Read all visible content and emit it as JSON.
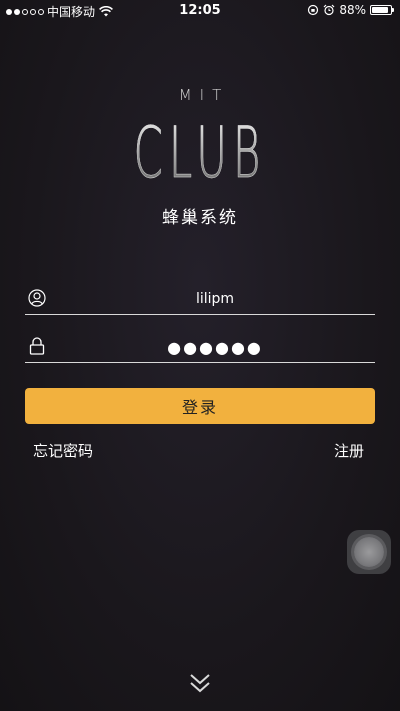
{
  "status_bar": {
    "carrier": "中国移动",
    "time": "12:05",
    "battery_percent": "88%",
    "battery_level": 0.88,
    "signal_strength": 2,
    "signal_total": 5
  },
  "logo": {
    "top": "MIT",
    "main": "CLUB"
  },
  "subtitle": "蜂巢系统",
  "username": {
    "value": "lilipm",
    "icon": "user-icon"
  },
  "password": {
    "value": "●●●●●●",
    "icon": "lock-icon"
  },
  "login_label": "登录",
  "forgot_label": "忘记密码",
  "register_label": "注册",
  "colors": {
    "accent": "#f2b13e",
    "background": "#1c191c"
  }
}
